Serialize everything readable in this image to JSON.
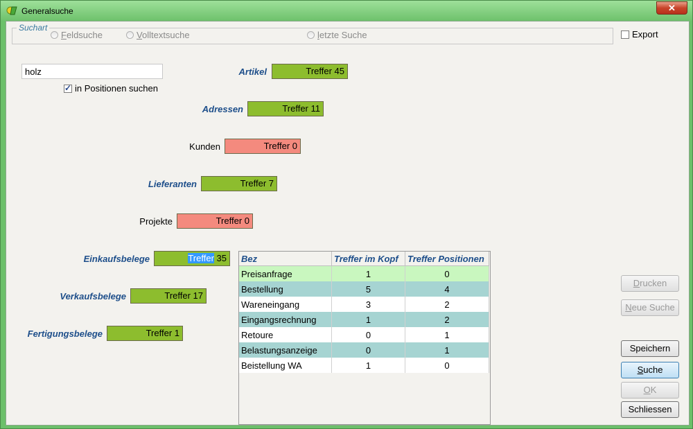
{
  "window": {
    "title": "Generalsuche",
    "close_label": "✕"
  },
  "suchart": {
    "legend": "Suchart",
    "options": [
      {
        "label": "Feldsuche"
      },
      {
        "label": "Volltextsuche"
      },
      {
        "label": "letzte Suche"
      }
    ]
  },
  "export": {
    "label": "Export",
    "checked": false
  },
  "search": {
    "value": "holz",
    "in_positions_label": "in Positionen suchen",
    "in_positions_checked": true
  },
  "categories": [
    {
      "label": "Artikel",
      "hits": "Treffer 45",
      "status": "found"
    },
    {
      "label": "Adressen",
      "hits": "Treffer 11",
      "status": "found"
    },
    {
      "label": "Kunden",
      "hits": "Treffer 0",
      "status": "none"
    },
    {
      "label": "Lieferanten",
      "hits": "Treffer 7",
      "status": "found"
    },
    {
      "label": "Projekte",
      "hits": "Treffer 0",
      "status": "none"
    },
    {
      "label": "Einkaufsbelege",
      "hits_highlight": "Treffer",
      "hits_rest": " 35",
      "status": "found"
    },
    {
      "label": "Verkaufsbelege",
      "hits": "Treffer 17",
      "status": "found"
    },
    {
      "label": "Fertigungsbelege",
      "hits": "Treffer 1",
      "status": "found"
    }
  ],
  "table": {
    "headers": [
      "Bez",
      "Treffer im Kopf",
      "Treffer Positionen"
    ],
    "rows": [
      [
        "Preisanfrage",
        "1",
        "0"
      ],
      [
        "Bestellung",
        "5",
        "4"
      ],
      [
        "Wareneingang",
        "3",
        "2"
      ],
      [
        "Eingangsrechnung",
        "1",
        "2"
      ],
      [
        "Retoure",
        "0",
        "1"
      ],
      [
        "Belastungsanzeige",
        "0",
        "1"
      ],
      [
        "Beistellung WA",
        "1",
        "0"
      ]
    ]
  },
  "buttons": {
    "drucken": "Drucken",
    "neue_suche": "Neue Suche",
    "speichern": "Speichern",
    "suche": "Suche",
    "ok": "OK",
    "schliessen": "Schliessen"
  },
  "colors": {
    "found": "#8dbd2e",
    "none": "#f48a7e",
    "label_blue": "#1d4e8a"
  }
}
